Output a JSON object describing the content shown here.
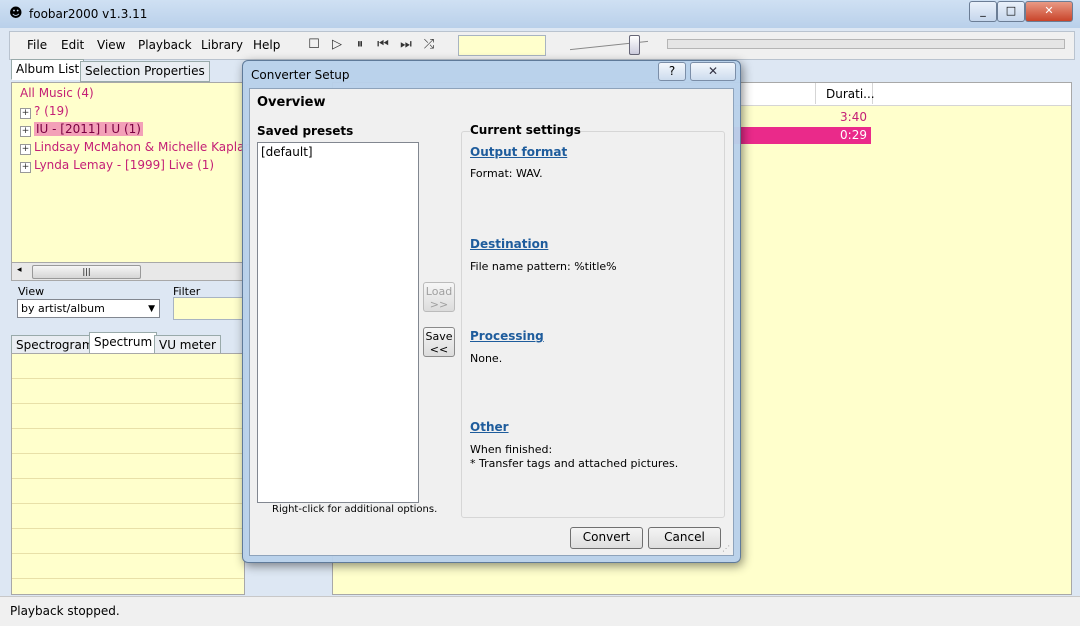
{
  "app": {
    "title": "foobar2000 v1.3.11",
    "caption_buttons": [
      "_",
      "□",
      "✕"
    ]
  },
  "menu": [
    "File",
    "Edit",
    "View",
    "Playback",
    "Library",
    "Help"
  ],
  "left_tabs": [
    "Album List",
    "Selection Properties"
  ],
  "tree": {
    "items": [
      {
        "label": "All Music (4)",
        "expandable": false,
        "selected": false
      },
      {
        "label": "? (19)",
        "expandable": true,
        "selected": false
      },
      {
        "label": "IU - [2011] I U (1)",
        "expandable": true,
        "selected": true
      },
      {
        "label": "Lindsay McMahon & Michelle Kaplan -",
        "expandable": true,
        "selected": false
      },
      {
        "label": "Lynda Lemay - [1999] Live (1)",
        "expandable": true,
        "selected": false
      }
    ]
  },
  "view": {
    "label": "View",
    "value": "by artist/album"
  },
  "filter": {
    "label": "Filter",
    "value": ""
  },
  "vis_tabs": [
    "Spectrogram",
    "Spectrum",
    "VU meter"
  ],
  "playlist": {
    "duration_header": "Durati...",
    "durations": [
      "3:40",
      "0:29"
    ]
  },
  "status": "Playback stopped.",
  "dialog": {
    "title": "Converter Setup",
    "help": "?",
    "overview": "Overview",
    "saved_presets_label": "Saved presets",
    "presets": [
      "[default]"
    ],
    "presets_hint": "Right-click for additional options.",
    "load_button": "Load\n>>",
    "save_button": "Save\n<<",
    "current_settings_label": "Current settings",
    "sections": [
      {
        "title": "Output format",
        "text": "Format: WAV."
      },
      {
        "title": "Destination",
        "text": "File name pattern: %title%"
      },
      {
        "title": "Processing",
        "text": "None."
      },
      {
        "title": "Other",
        "text": "When finished:\n* Transfer tags and attached pictures."
      }
    ],
    "convert_button": "Convert",
    "cancel_button": "Cancel"
  },
  "colors": {
    "accent_pink": "#ea2a8a",
    "yellow_bg": "#ffffcc",
    "tree_text": "#c41f76",
    "link": "#1e5c9c"
  }
}
